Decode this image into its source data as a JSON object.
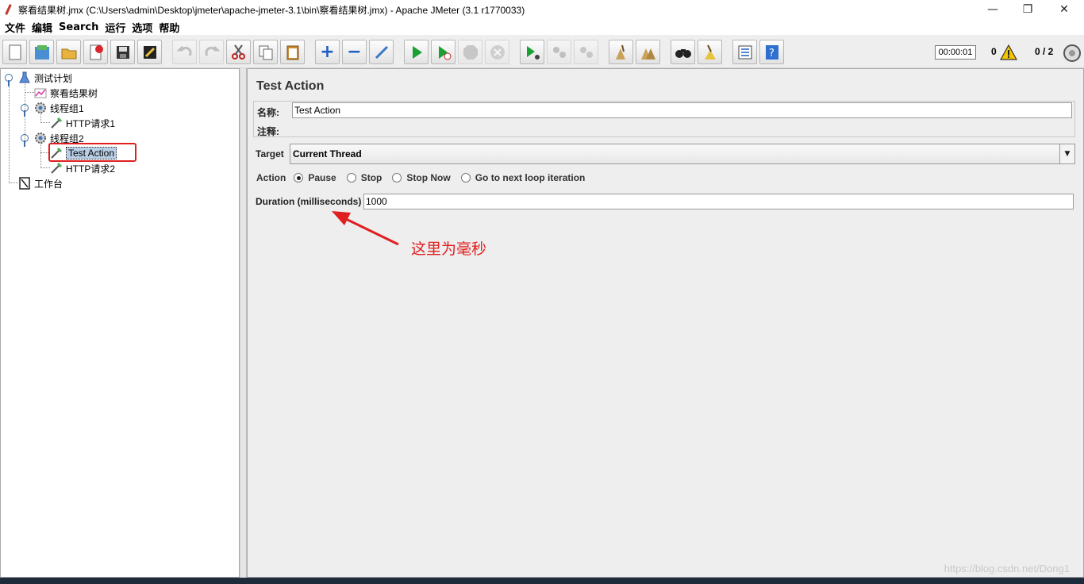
{
  "window": {
    "title": "察看结果树.jmx (C:\\Users\\admin\\Desktop\\jmeter\\apache-jmeter-3.1\\bin\\察看结果树.jmx) - Apache JMeter (3.1 r1770033)",
    "minimize": "—",
    "maximize": "❐",
    "close": "✕"
  },
  "menu": [
    "文件",
    "编辑",
    "Search",
    "运行",
    "选项",
    "帮助"
  ],
  "toolbar": {
    "timer": "00:00:01",
    "error_count": "0",
    "threads": "0 / 2"
  },
  "tree": {
    "items": [
      {
        "label": "测试计划",
        "icon": "test-plan-icon"
      },
      {
        "label": "察看结果树",
        "icon": "listener-icon"
      },
      {
        "label": "线程组1",
        "icon": "thread-group-icon"
      },
      {
        "label": "HTTP请求1",
        "icon": "sampler-icon"
      },
      {
        "label": "线程组2",
        "icon": "thread-group-icon"
      },
      {
        "label": "Test Action",
        "icon": "sampler-icon"
      },
      {
        "label": "HTTP请求2",
        "icon": "sampler-icon"
      },
      {
        "label": "工作台",
        "icon": "workbench-icon"
      }
    ]
  },
  "panel": {
    "title": "Test Action",
    "name_label": "名称:",
    "name_value": "Test Action",
    "comment_label": "注释:",
    "target_label": "Target",
    "target_value": "Current Thread",
    "action_label": "Action",
    "actions": [
      "Pause",
      "Stop",
      "Stop Now",
      "Go to next loop iteration"
    ],
    "selected_action": "Pause",
    "duration_label": "Duration (milliseconds)",
    "duration_value": "1000"
  },
  "annotation": {
    "text": "这里为毫秒",
    "color": "#e02020"
  },
  "watermark": "https://blog.csdn.net/Dong1"
}
